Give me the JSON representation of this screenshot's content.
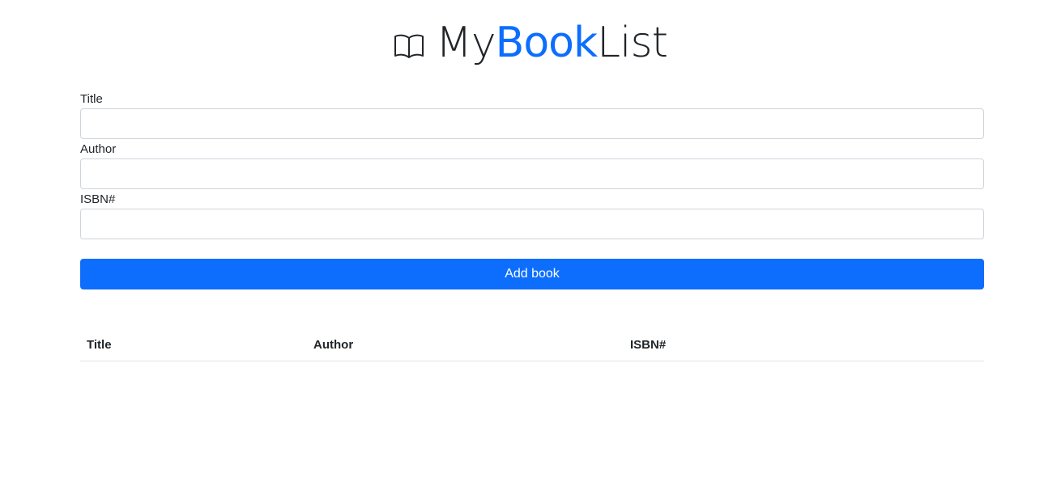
{
  "brand": {
    "prefix": "My",
    "accent": "Book",
    "suffix": "List",
    "icon": "open-book-icon",
    "accent_color": "#0d6efd"
  },
  "form": {
    "title_label": "Title",
    "title_value": "",
    "author_label": "Author",
    "author_value": "",
    "isbn_label": "ISBN#",
    "isbn_value": "",
    "submit_label": "Add book"
  },
  "table": {
    "columns": [
      "Title",
      "Author",
      "ISBN#"
    ],
    "rows": []
  }
}
